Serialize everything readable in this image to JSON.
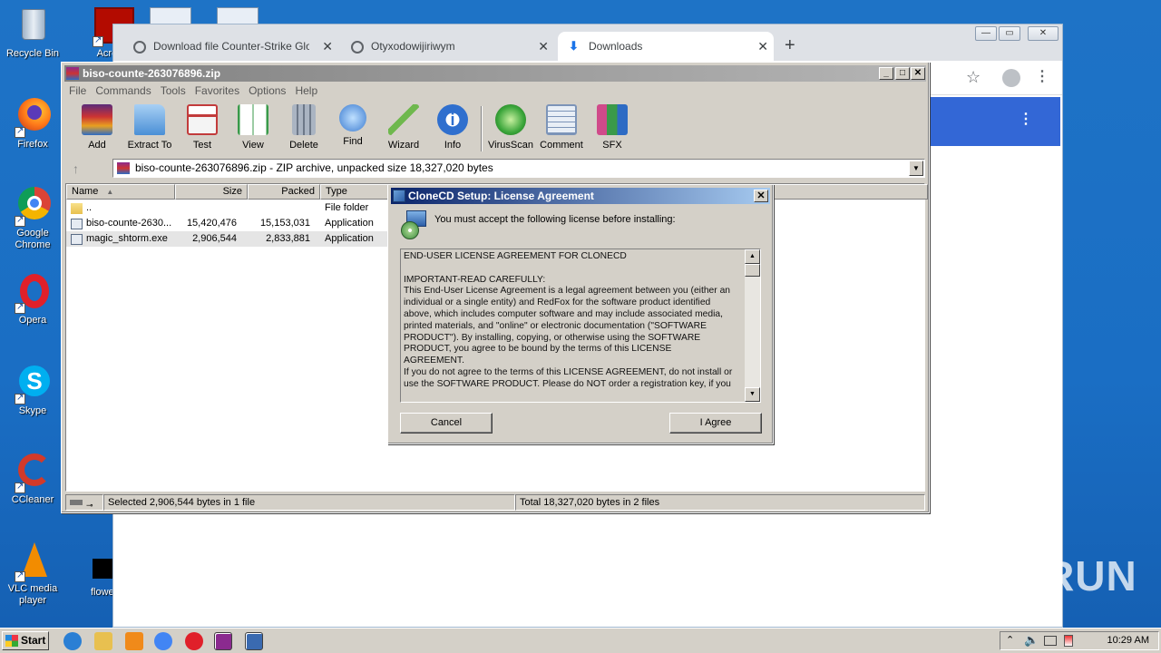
{
  "desktop": {
    "icons": [
      {
        "label": "Recycle Bin",
        "icon": "recycle-bin-icon",
        "color": "#cfd8e6"
      },
      {
        "label": "Firefox",
        "icon": "firefox-icon",
        "color": "#e66000"
      },
      {
        "label": "Google Chrome",
        "icon": "chrome-icon",
        "color": "#4285f4"
      },
      {
        "label": "Opera",
        "icon": "opera-icon",
        "color": "#e0202a"
      },
      {
        "label": "Skype",
        "icon": "skype-icon",
        "color": "#00aff0"
      },
      {
        "label": "CCleaner",
        "icon": "ccleaner-icon",
        "color": "#d23a2a"
      },
      {
        "label": "VLC media player",
        "icon": "vlc-icon",
        "color": "#f28c00"
      }
    ],
    "partial_icons": [
      {
        "label": "Acroba",
        "icon": "acrobat-icon"
      },
      {
        "label": "flowersst",
        "icon": "file-icon"
      }
    ]
  },
  "chrome": {
    "tabs": [
      {
        "label": "Download file Counter-Strike Global",
        "close": "✕"
      },
      {
        "label": "Otyxodowijiriwym",
        "close": "✕"
      },
      {
        "label": "Downloads",
        "close": "✕"
      }
    ],
    "new_tab": "+"
  },
  "winrar": {
    "title": "biso-counte-263076896.zip",
    "menu": [
      "File",
      "Commands",
      "Tools",
      "Favorites",
      "Options",
      "Help"
    ],
    "toolbar": [
      {
        "label": "Add",
        "icon": "add-archive-icon",
        "color": "#8a3a3a"
      },
      {
        "label": "Extract To",
        "icon": "extract-folder-icon",
        "color": "#4a8fd6"
      },
      {
        "label": "Test",
        "icon": "test-clipboard-icon",
        "color": "#c23b3b"
      },
      {
        "label": "View",
        "icon": "view-book-icon",
        "color": "#3a9a4a"
      },
      {
        "label": "Delete",
        "icon": "delete-trash-icon",
        "color": "#8894a4"
      },
      {
        "label": "Find",
        "icon": "find-magnifier-icon",
        "color": "#3b7bd0"
      },
      {
        "label": "Wizard",
        "icon": "wizard-wand-icon",
        "color": "#6fb84e"
      },
      {
        "label": "Info",
        "icon": "info-icon",
        "color": "#2f6fce"
      },
      {
        "label": "VirusScan",
        "icon": "virusscan-bug-icon",
        "color": "#3aa53a"
      },
      {
        "label": "Comment",
        "icon": "comment-icon",
        "color": "#7c94b8"
      },
      {
        "label": "SFX",
        "icon": "sfx-books-icon",
        "color": "#d04a8a"
      }
    ],
    "address": "biso-counte-263076896.zip - ZIP archive, unpacked size 18,327,020 bytes",
    "columns": [
      "Name",
      "Size",
      "Packed",
      "Type"
    ],
    "files": [
      {
        "name": "..",
        "size": "",
        "packed": "",
        "type": "File folder",
        "icon": "folder-icon"
      },
      {
        "name": "biso-counte-2630...",
        "size": "15,420,476",
        "packed": "15,153,031",
        "type": "Application",
        "icon": "application-icon"
      },
      {
        "name": "magic_shtorm.exe",
        "size": "2,906,544",
        "packed": "2,833,881",
        "type": "Application",
        "icon": "application-icon"
      }
    ],
    "status_left": "Selected 2,906,544 bytes in 1 file",
    "status_right": "Total 18,327,020 bytes in 2 files"
  },
  "dialog": {
    "title": "CloneCD Setup: License Agreement",
    "prompt": "You must accept the following license before installing:",
    "license_lines": [
      "END-USER LICENSE AGREEMENT FOR CLONECD",
      "",
      "IMPORTANT-READ CAREFULLY:",
      "This End-User License Agreement is a legal agreement between you (either an",
      "individual or a single entity) and RedFox for the software product identified",
      "above, which includes computer software and may include associated media,",
      "printed materials, and \"online\" or electronic documentation (\"SOFTWARE",
      "PRODUCT\"). By installing, copying, or otherwise using the SOFTWARE",
      "PRODUCT, you agree to be bound by the terms of this LICENSE",
      "AGREEMENT.",
      "If you do not agree to the terms of this LICENSE AGREEMENT, do not install or",
      "use the SOFTWARE PRODUCT. Please do NOT order a registration key, if you"
    ],
    "cancel_label": "Cancel",
    "agree_label": "I Agree",
    "close": "✕"
  },
  "taskbar": {
    "start_label": "Start",
    "clock": "10:29 AM",
    "pinned": [
      {
        "icon": "ie-icon",
        "color": "#2a7fd4"
      },
      {
        "icon": "explorer-folder-icon",
        "color": "#e8c050"
      },
      {
        "icon": "media-player-icon",
        "color": "#f08a1a"
      },
      {
        "icon": "chrome-icon",
        "color": "#4285f4"
      },
      {
        "icon": "opera-icon",
        "color": "#e0202a"
      },
      {
        "icon": "winrar-icon",
        "color": "#8b2a8f"
      },
      {
        "icon": "setup-icon",
        "color": "#3a6ab0"
      }
    ]
  },
  "watermark": "ANY RUN"
}
